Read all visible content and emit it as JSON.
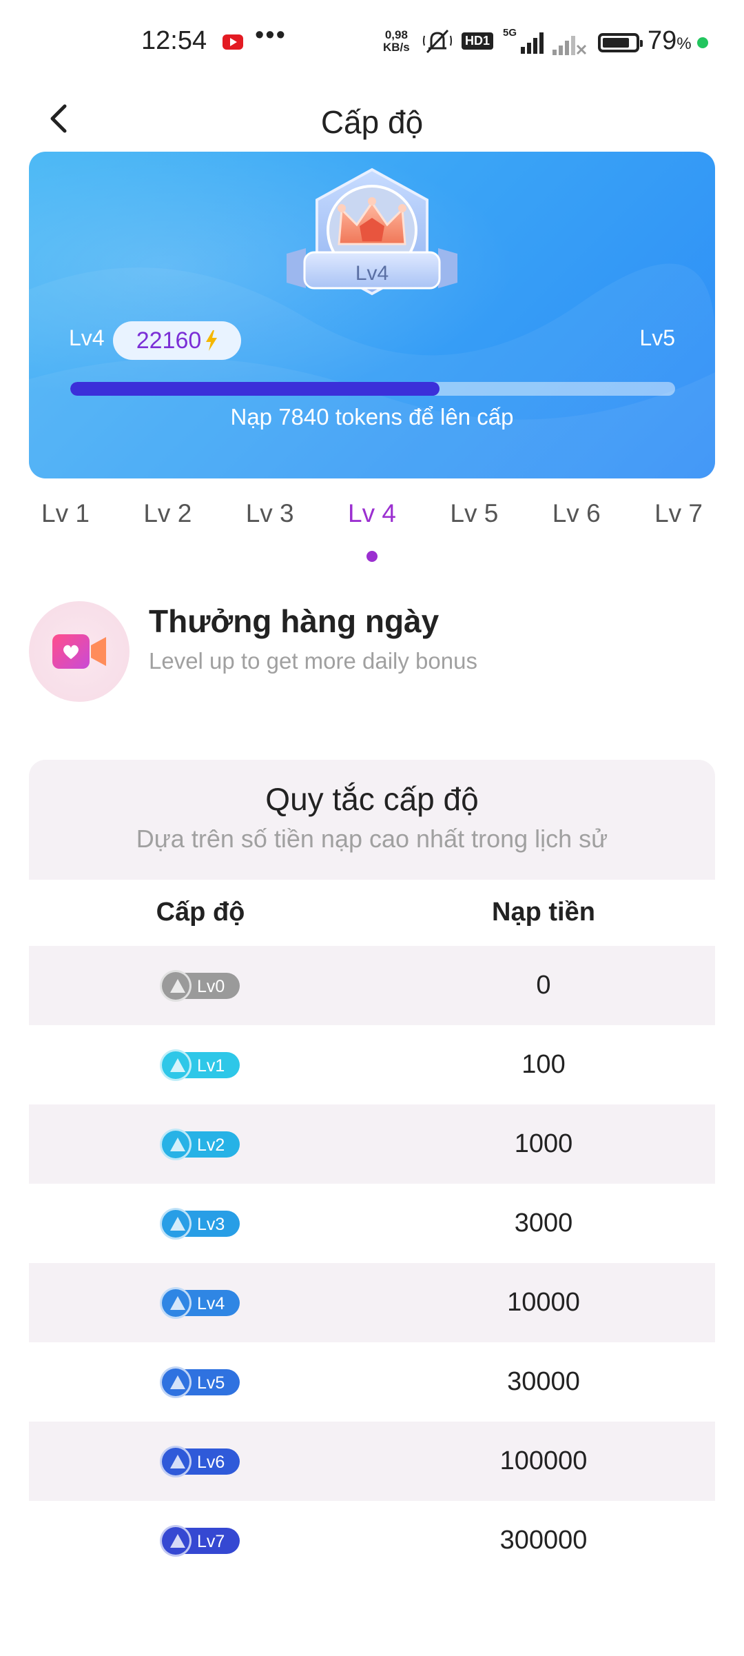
{
  "status_bar": {
    "time": "12:54",
    "network_speed_value": "0,98",
    "network_speed_unit": "KB/s",
    "hd_label": "HD1",
    "network_type": "5G",
    "battery_percent": "79",
    "battery_percent_sign": "%",
    "overflow_dots": "•••",
    "dot_color": "#22c55e"
  },
  "header": {
    "title": "Cấp độ"
  },
  "hero": {
    "badge_level": "Lv4",
    "current_level": "Lv4",
    "next_level": "Lv5",
    "points": "22160",
    "progress_fraction": 0.61,
    "hint": "Nạp 7840 tokens để lên cấp"
  },
  "tabs": {
    "items": [
      "Lv 1",
      "Lv 2",
      "Lv 3",
      "Lv 4",
      "Lv 5",
      "Lv 6",
      "Lv 7"
    ],
    "active_index": 3
  },
  "daily_bonus": {
    "title": "Thưởng hàng ngày",
    "subtitle": "Level up to get more daily bonus"
  },
  "rules": {
    "title": "Quy tắc cấp độ",
    "subtitle": "Dựa trên số tiền nạp cao nhất trong lịch sử",
    "col_level": "Cấp độ",
    "col_deposit": "Nạp tiền",
    "rows": [
      {
        "badge": "Lv0",
        "deposit": "0",
        "color": "#9a9a9a"
      },
      {
        "badge": "Lv1",
        "deposit": "100",
        "color": "#2ec7e8"
      },
      {
        "badge": "Lv2",
        "deposit": "1000",
        "color": "#27b2e6"
      },
      {
        "badge": "Lv3",
        "deposit": "3000",
        "color": "#289ee6"
      },
      {
        "badge": "Lv4",
        "deposit": "10000",
        "color": "#2f86e4"
      },
      {
        "badge": "Lv5",
        "deposit": "30000",
        "color": "#2f72e0"
      },
      {
        "badge": "Lv6",
        "deposit": "100000",
        "color": "#2f5ad9"
      },
      {
        "badge": "Lv7",
        "deposit": "300000",
        "color": "#3548d2"
      }
    ]
  },
  "colors": {
    "accent": "#9b2fd0",
    "progress_fill": "#3b2fd9",
    "hero_blue": "#3aa4f6"
  }
}
